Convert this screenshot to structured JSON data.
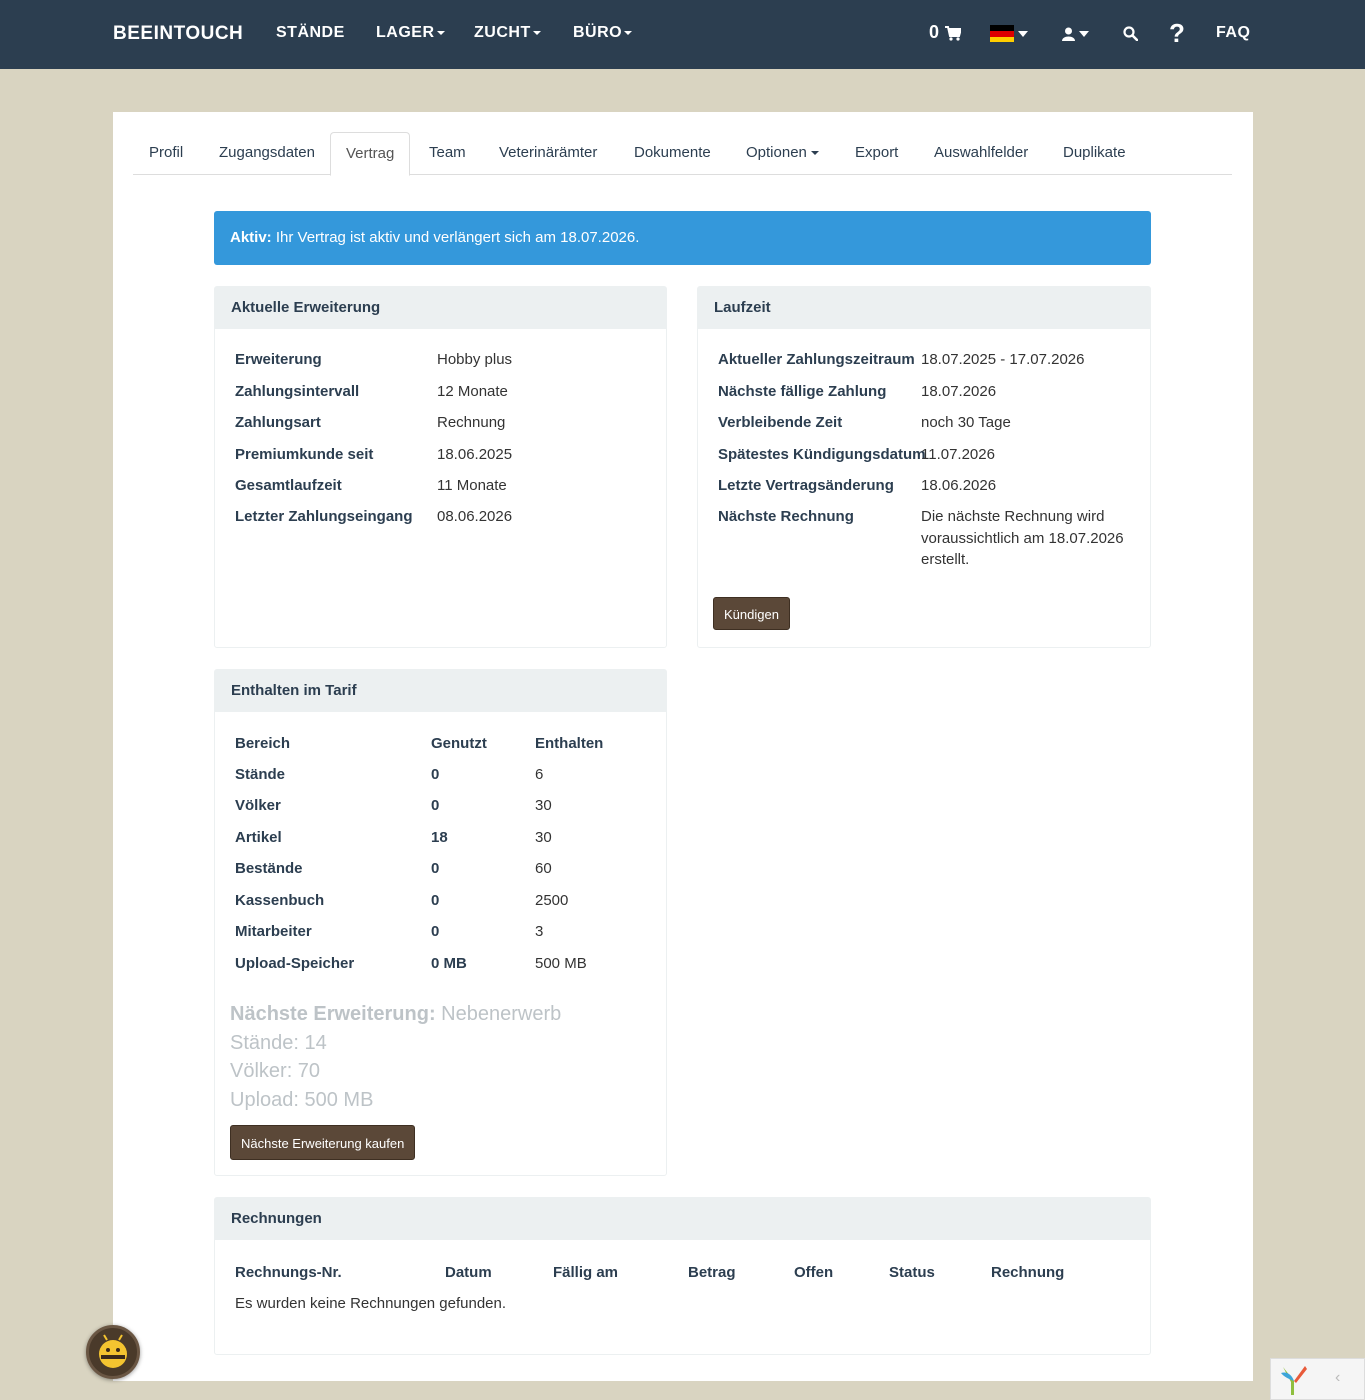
{
  "navbar": {
    "brand": "BEEINTOUCH",
    "items": [
      "STÄNDE",
      "LAGER",
      "ZUCHT",
      "BÜRO"
    ],
    "cart_count": "0",
    "faq": "FAQ",
    "help": "?"
  },
  "tabs": [
    "Profil",
    "Zugangsdaten",
    "Vertrag",
    "Team",
    "Veterinärämter",
    "Dokumente",
    "Optionen",
    "Export",
    "Auswahlfelder",
    "Duplikate"
  ],
  "alert": {
    "strong": "Aktiv:",
    "text": " Ihr Vertrag ist aktiv und verlängert sich am 18.07.2026."
  },
  "current_extension": {
    "title": "Aktuelle Erweiterung",
    "rows": [
      {
        "label": "Erweiterung",
        "value": "Hobby plus"
      },
      {
        "label": "Zahlungsintervall",
        "value": "12 Monate"
      },
      {
        "label": "Zahlungsart",
        "value": "Rechnung"
      },
      {
        "label": "Premiumkunde seit",
        "value": "18.06.2025"
      },
      {
        "label": "Gesamtlaufzeit",
        "value": "11 Monate"
      },
      {
        "label": "Letzter Zahlungseingang",
        "value": "08.06.2026"
      }
    ]
  },
  "term": {
    "title": "Laufzeit",
    "rows": [
      {
        "label": "Aktueller Zahlungszeitraum",
        "value": "18.07.2025 - 17.07.2026"
      },
      {
        "label": "Nächste fällige Zahlung",
        "value": "18.07.2026"
      },
      {
        "label": "Verbleibende Zeit",
        "value": "noch 30 Tage"
      },
      {
        "label": "Spätestes Kündigungsdatum",
        "value": "11.07.2026"
      },
      {
        "label": "Letzte Vertragsänderung",
        "value": "18.06.2026"
      }
    ],
    "next_invoice_label": "Nächste Rechnung",
    "next_invoice_lines": [
      "Die nächste Rechnung wird",
      "voraussichtlich am 18.07.2026",
      "erstellt."
    ],
    "cancel_button": "Kündigen"
  },
  "tariff": {
    "title": "Enthalten im Tarif",
    "headers": [
      "Bereich",
      "Genutzt",
      "Enthalten"
    ],
    "rows": [
      [
        "Stände",
        "0",
        "6"
      ],
      [
        "Völker",
        "0",
        "30"
      ],
      [
        "Artikel",
        "18",
        "30"
      ],
      [
        "Bestände",
        "0",
        "60"
      ],
      [
        "Kassenbuch",
        "0",
        "2500"
      ],
      [
        "Mitarbeiter",
        "0",
        "3"
      ],
      [
        "Upload-Speicher",
        "0 MB",
        "500 MB"
      ]
    ],
    "next_label": "Nächste Erweiterung:",
    "next_value": " Nebenerwerb",
    "next_details": [
      "Stände: 14",
      "Völker: 70",
      "Upload: 500 MB"
    ],
    "buy_button": "Nächste Erweiterung kaufen"
  },
  "invoices": {
    "title": "Rechnungen",
    "headers": [
      "Rechnungs-Nr.",
      "Datum",
      "Fällig am",
      "Betrag",
      "Offen",
      "Status",
      "Rechnung"
    ],
    "empty": "Es wurden keine Rechnungen gefunden."
  },
  "colors": {
    "navbar": "#2c3e50",
    "page_bg": "#d9d4c1",
    "alert": "#3498db",
    "button": "#5b4838"
  }
}
